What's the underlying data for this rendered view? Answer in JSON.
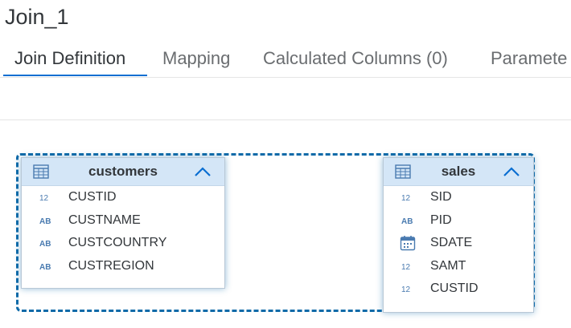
{
  "window": {
    "title": "Join_1"
  },
  "tabs": [
    {
      "label": "Join Definition",
      "active": true
    },
    {
      "label": "Mapping",
      "active": false
    },
    {
      "label": "Calculated Columns (0)",
      "active": false
    },
    {
      "label": "Paramete",
      "active": false
    }
  ],
  "nodes": {
    "customers": {
      "title": "customers",
      "columns": [
        {
          "name": "CUSTID",
          "type": "number-icon"
        },
        {
          "name": "CUSTNAME",
          "type": "text-icon"
        },
        {
          "name": "CUSTCOUNTRY",
          "type": "text-icon"
        },
        {
          "name": "CUSTREGION",
          "type": "text-icon"
        }
      ]
    },
    "sales": {
      "title": "sales",
      "columns": [
        {
          "name": "SID",
          "type": "number-icon"
        },
        {
          "name": "PID",
          "type": "text-icon"
        },
        {
          "name": "SDATE",
          "type": "calendar-icon"
        },
        {
          "name": "SAMT",
          "type": "number-icon"
        },
        {
          "name": "CUSTID",
          "type": "number-icon"
        }
      ]
    }
  },
  "colors": {
    "accent": "#0a6ed1",
    "join_border": "#0f6aa8",
    "node_header": "#d4e6f7",
    "icon": "#4a7bb0"
  }
}
